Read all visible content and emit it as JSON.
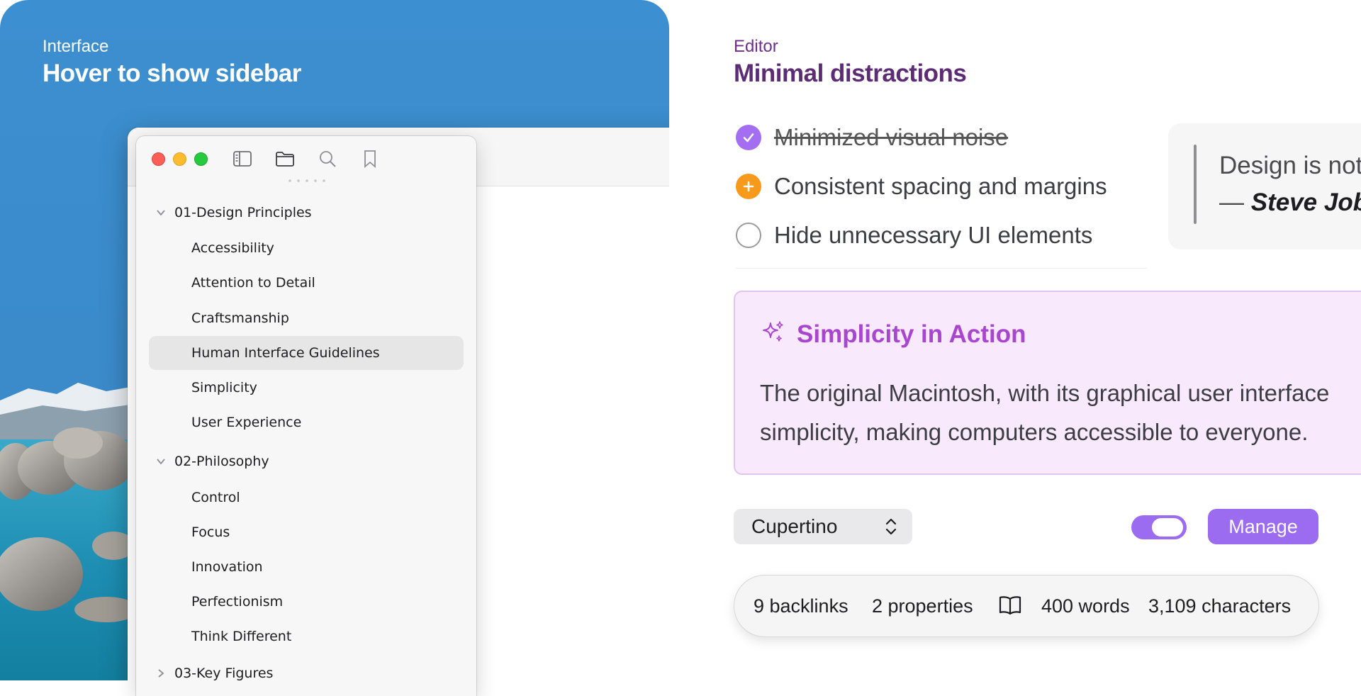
{
  "left": {
    "eyebrow": "Interface",
    "title": "Hover to show sidebar"
  },
  "sidebar": {
    "toolbar_icons": [
      "sidebar-toggle-icon",
      "folder-icon",
      "search-icon",
      "bookmark-icon"
    ],
    "tree": [
      {
        "type": "folder",
        "label": "01-Design Principles",
        "expanded": true
      },
      {
        "type": "file",
        "label": "Accessibility"
      },
      {
        "type": "file",
        "label": "Attention to Detail"
      },
      {
        "type": "file",
        "label": "Craftsmanship"
      },
      {
        "type": "file",
        "label": "Human Interface Guidelines",
        "selected": true
      },
      {
        "type": "file",
        "label": "Simplicity"
      },
      {
        "type": "file",
        "label": "User Experience"
      },
      {
        "type": "folder",
        "label": "02-Philosophy",
        "expanded": true
      },
      {
        "type": "file",
        "label": "Control"
      },
      {
        "type": "file",
        "label": "Focus"
      },
      {
        "type": "file",
        "label": "Innovation"
      },
      {
        "type": "file",
        "label": "Perfectionism"
      },
      {
        "type": "file",
        "label": "Think Different"
      },
      {
        "type": "folder",
        "label": "03-Key Figures",
        "expanded": false
      }
    ]
  },
  "editor": {
    "eyebrow": "Editor",
    "title": "Minimal distractions",
    "tasks": [
      {
        "label": "Minimized visual noise",
        "state": "done"
      },
      {
        "label": "Consistent spacing and margins",
        "state": "partial"
      },
      {
        "label": "Hide unnecessary UI elements",
        "state": "todo"
      }
    ],
    "quote": {
      "text": "Design is not",
      "dash": "— ",
      "author": "Steve Job"
    },
    "callout": {
      "title": "Simplicity in Action",
      "line1": "The original Macintosh, with its graphical user interface",
      "line2": "simplicity, making computers accessible to everyone."
    },
    "select": {
      "value": "Cupertino"
    },
    "toggle": {
      "on": true
    },
    "manage_label": "Manage",
    "status": {
      "backlinks": "9 backlinks",
      "properties": "2 properties",
      "words": "400 words",
      "characters": "3,109 characters"
    }
  },
  "colors": {
    "accent": "#9b6cf0",
    "callout_title": "#a846cf",
    "callout_bg": "#f8e9fc",
    "editor_title": "#5c2c75",
    "left_bg": "#3a87c6"
  }
}
